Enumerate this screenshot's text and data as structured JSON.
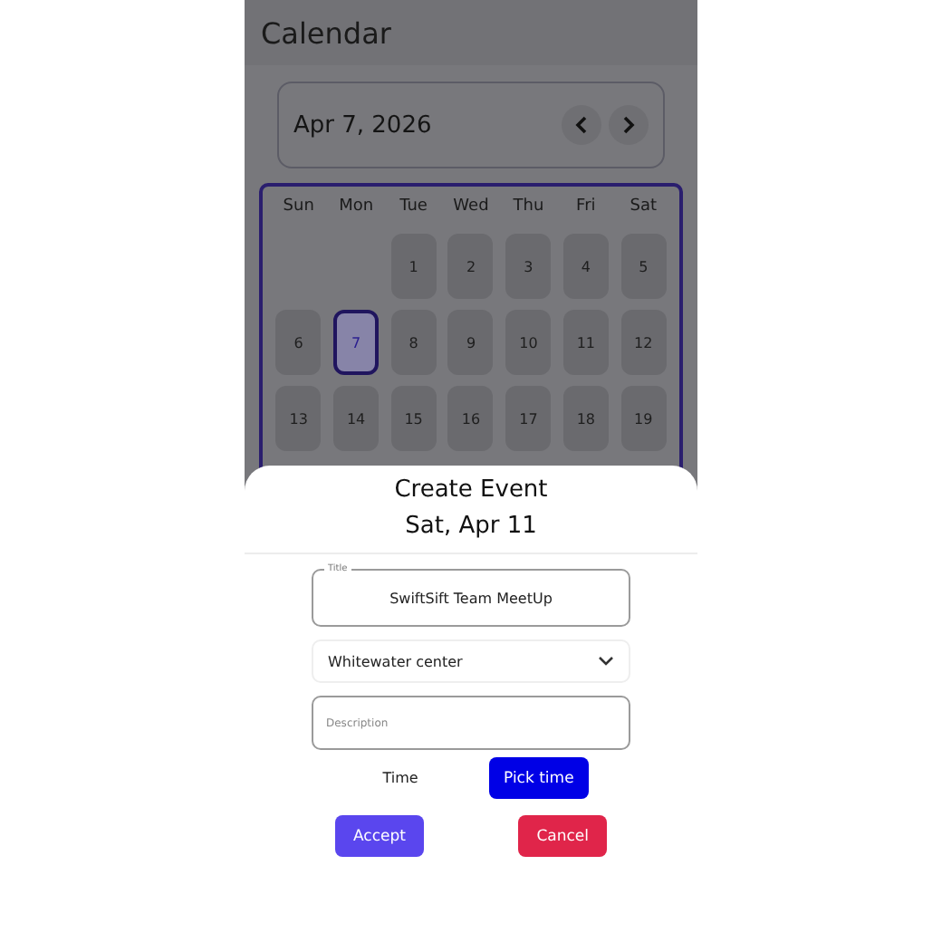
{
  "header": {
    "title": "Calendar"
  },
  "month_bar": {
    "date": "Apr 7, 2026"
  },
  "calendar": {
    "weekdays": [
      "Sun",
      "Mon",
      "Tue",
      "Wed",
      "Thu",
      "Fri",
      "Sat"
    ],
    "weeks": [
      [
        {
          "kind": "blank"
        },
        {
          "kind": "blank"
        },
        {
          "kind": "day",
          "label": "1",
          "selected": false
        },
        {
          "kind": "day",
          "label": "2",
          "selected": false
        },
        {
          "kind": "day",
          "label": "3",
          "selected": false
        },
        {
          "kind": "day",
          "label": "4",
          "selected": false
        },
        {
          "kind": "day",
          "label": "5",
          "selected": false
        }
      ],
      [
        {
          "kind": "day",
          "label": "6",
          "selected": false
        },
        {
          "kind": "day",
          "label": "7",
          "selected": true
        },
        {
          "kind": "day",
          "label": "8",
          "selected": false
        },
        {
          "kind": "day",
          "label": "9",
          "selected": false
        },
        {
          "kind": "day",
          "label": "10",
          "selected": false
        },
        {
          "kind": "day",
          "label": "11",
          "selected": false
        },
        {
          "kind": "day",
          "label": "12",
          "selected": false
        }
      ],
      [
        {
          "kind": "day",
          "label": "13",
          "selected": false
        },
        {
          "kind": "day",
          "label": "14",
          "selected": false
        },
        {
          "kind": "day",
          "label": "15",
          "selected": false
        },
        {
          "kind": "day",
          "label": "16",
          "selected": false
        },
        {
          "kind": "day",
          "label": "17",
          "selected": false
        },
        {
          "kind": "day",
          "label": "18",
          "selected": false
        },
        {
          "kind": "day",
          "label": "19",
          "selected": false
        }
      ]
    ]
  },
  "dialog": {
    "title": "Create Event",
    "date": "Sat, Apr 11",
    "title_field": {
      "label": "Title",
      "value": "SwiftSift Team MeetUp"
    },
    "location_select": {
      "value": "Whitewater center"
    },
    "description_field": {
      "placeholder": "Description"
    },
    "time_label": "Time",
    "pick_time_button": "Pick time",
    "buttons": [
      {
        "kind": "accept",
        "label": "Accept"
      },
      {
        "kind": "cancel",
        "label": "Cancel"
      }
    ]
  }
}
